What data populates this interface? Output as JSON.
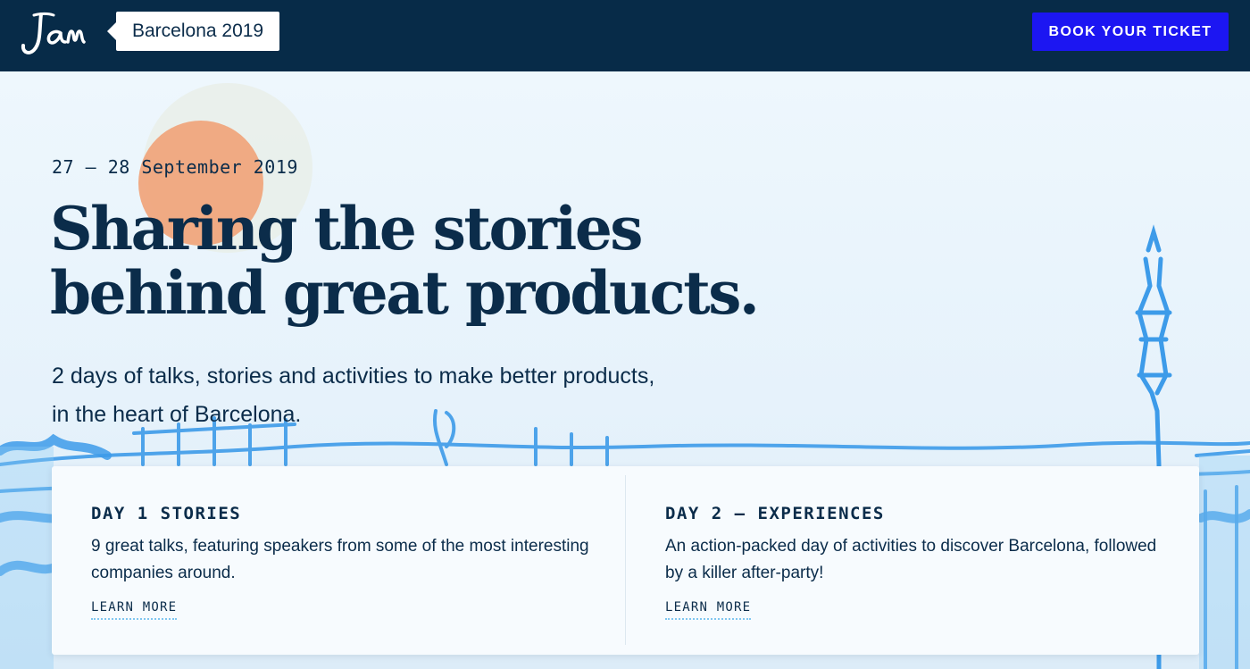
{
  "header": {
    "logo_text": "Jam",
    "event_label": "Barcelona 2019",
    "cta_label": "BOOK YOUR TICKET"
  },
  "hero": {
    "date": "27 – 28 September 2019",
    "headline_line1": "Sharing the stories",
    "headline_line2": "behind great products.",
    "subtitle_line1": "2 days of talks, stories and activities to make better products,",
    "subtitle_line2": "in the heart of Barcelona."
  },
  "days": [
    {
      "title": "DAY 1 STORIES",
      "description": "9 great talks, featuring speakers from some of the most interesting companies around.",
      "link_label": "LEARN MORE"
    },
    {
      "title": "DAY 2 – EXPERIENCES",
      "description": "An action-packed day of activities to discover Barcelona, followed by a killer after-party!",
      "link_label": "LEARN MORE"
    }
  ],
  "colors": {
    "navy": "#072b48",
    "text": "#0b2c4a",
    "cta": "#1c16f2",
    "sun": "#f0a57d",
    "sketch": "#3d9be9"
  }
}
